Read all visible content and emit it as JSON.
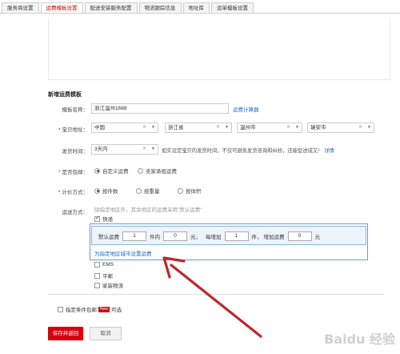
{
  "tabs": [
    "服务商设置",
    "运费模板设置",
    "配送安装服务配置",
    "物流跟踪信息",
    "地址库",
    "运单模板设置"
  ],
  "active_tab_index": 1,
  "section_title": "新增运费模板",
  "form": {
    "template_name_label": "模板名称：",
    "template_name_value": "浙江温州1688",
    "calculator_link": "运费计算器",
    "address_label": "宝贝地址：",
    "country": "中国",
    "province": "浙江省",
    "city": "温州市",
    "district": "瑞安市",
    "ship_time_label": "发货时间：",
    "ship_time_value": "3天内",
    "ship_time_hint": "如实设定宝贝的发货时间，不仅可避免发货咨询和纠纷，还能促进成交！",
    "ship_time_detail_link": "详情",
    "free_shipping_label": "是否包邮：",
    "free_shipping_opt1": "自定义运费",
    "free_shipping_opt2": "卖家承担运费",
    "pricing_label": "计价方式：",
    "pricing_opt1": "按件数",
    "pricing_opt2": "按重量",
    "pricing_opt3": "按体积",
    "method_label": "运送方式：",
    "method_hint": "除指定地区外，其余地区的运费采用\"默认运费\"",
    "express_label": "快递",
    "default_freight_label": "默认运费",
    "default_qty": "1",
    "unit_piece": "件内",
    "default_price": "0",
    "unit_yuan": "元，",
    "each_add_label": "每增加",
    "add_qty": "1",
    "unit_piece2": "件，",
    "add_freight_label": "增加运费",
    "add_price": "0",
    "unit_yuan2": "元",
    "set_region_link": "为指定地区城市设置运费",
    "ems_label": "EMS",
    "mail_label": "平邮",
    "home_logistics_label": "家装物流",
    "conditional_free_label": "指定条件包邮",
    "new_badge": "New",
    "optional_label": "可选"
  },
  "buttons": {
    "save": "保存并返回",
    "cancel": "取消"
  },
  "watermark": "Baidu 经验",
  "colors": {
    "accent_red": "#d7000f",
    "link_blue": "#1a6bc4",
    "arrow_red": "#c0262c"
  }
}
